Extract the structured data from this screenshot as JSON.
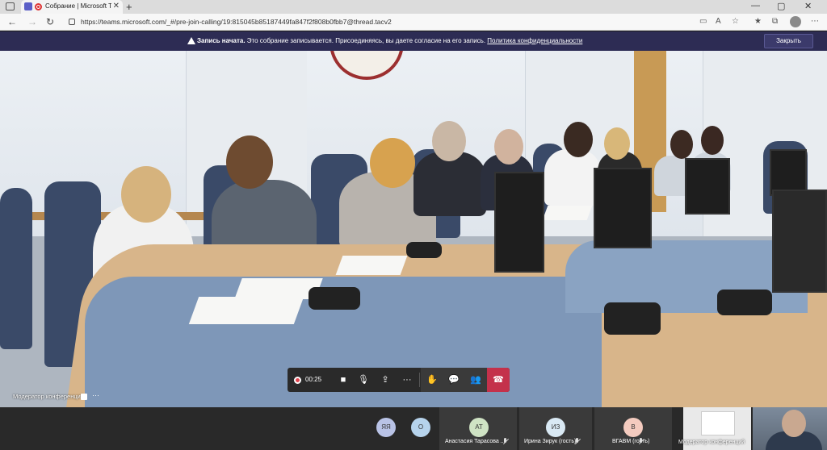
{
  "browser": {
    "tab_title": "Собрание | Microsoft Teams",
    "tab_close": "✕",
    "new_tab": "+",
    "url": "https://teams.microsoft.com/_#/pre-join-calling/19:815045b85187449fa847f2f808b0fbb7@thread.tacv2",
    "window_controls": [
      "—",
      "▢",
      "✕"
    ]
  },
  "notice": {
    "bold": "Запись начата.",
    "text": " Это собрание записывается. Присоединяясь, вы даете согласие на его запись. ",
    "link": "Политика конфиденциальности",
    "close_label": "Закрыть"
  },
  "stage": {
    "speaker_label": "Модератор конференций",
    "more": "···"
  },
  "controls": {
    "timer": "00:25"
  },
  "participants": [
    {
      "initials": "ЯЯ",
      "color": "#b9c3e6"
    },
    {
      "initials": "О",
      "color": "#b6d3ec"
    },
    {
      "initials": "АТ",
      "color": "#cfe3c4",
      "name": "Анастасия Тарасова ..."
    },
    {
      "initials": "ИЗ",
      "color": "#d9e9f4",
      "name": "Ирина Зирук (гость)"
    },
    {
      "initials": "В",
      "color": "#f4cbbf",
      "name": "ВГАВМ (гость)"
    }
  ],
  "thumbnail_label": "Модератор конференций",
  "colors": {
    "notice_bg": "#2d2c54",
    "hangup": "#c4314b",
    "record": "#e0434e",
    "teams_brand": "#5b5fc7"
  }
}
